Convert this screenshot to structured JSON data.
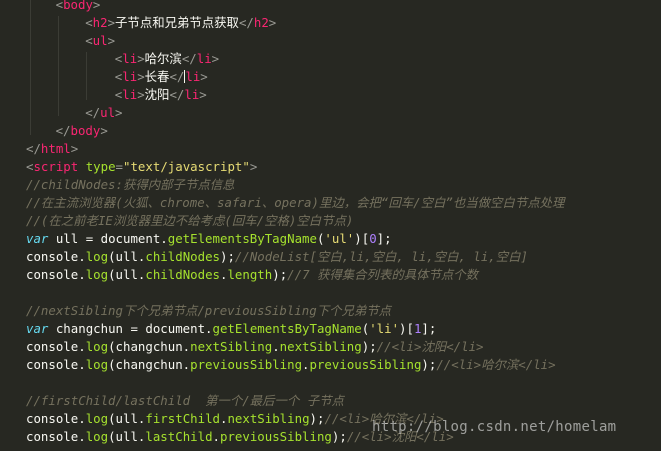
{
  "code_lines": [
    {
      "indent": 4,
      "tokens": [
        [
          "punct",
          "<"
        ],
        [
          "tag",
          "body"
        ],
        [
          "punct",
          ">"
        ]
      ]
    },
    {
      "indent": 8,
      "tokens": [
        [
          "punct",
          "<"
        ],
        [
          "tag",
          "h2"
        ],
        [
          "punct",
          ">"
        ],
        [
          "text",
          "子节点和兄弟节点获取"
        ],
        [
          "punct",
          "</"
        ],
        [
          "tag",
          "h2"
        ],
        [
          "punct",
          ">"
        ]
      ]
    },
    {
      "indent": 8,
      "tokens": [
        [
          "punct",
          "<"
        ],
        [
          "tag",
          "ul"
        ],
        [
          "punct",
          ">"
        ]
      ]
    },
    {
      "indent": 12,
      "tokens": [
        [
          "punct",
          "<"
        ],
        [
          "tag",
          "li"
        ],
        [
          "punct",
          ">"
        ],
        [
          "text",
          "哈尔滨"
        ],
        [
          "punct",
          "</"
        ],
        [
          "tag",
          "li"
        ],
        [
          "punct",
          ">"
        ]
      ]
    },
    {
      "indent": 12,
      "caret_after": 4,
      "tokens": [
        [
          "punct",
          "<"
        ],
        [
          "tag",
          "li"
        ],
        [
          "punct",
          ">"
        ],
        [
          "text",
          "长春"
        ],
        [
          "punct",
          "</"
        ],
        [
          "tag",
          "li"
        ],
        [
          "punct",
          ">"
        ]
      ]
    },
    {
      "indent": 12,
      "tokens": [
        [
          "punct",
          "<"
        ],
        [
          "tag",
          "li"
        ],
        [
          "punct",
          ">"
        ],
        [
          "text",
          "沈阳"
        ],
        [
          "punct",
          "</"
        ],
        [
          "tag",
          "li"
        ],
        [
          "punct",
          ">"
        ]
      ]
    },
    {
      "indent": 8,
      "tokens": [
        [
          "punct",
          "</"
        ],
        [
          "tag",
          "ul"
        ],
        [
          "punct",
          ">"
        ]
      ]
    },
    {
      "indent": 4,
      "tokens": [
        [
          "punct",
          "</"
        ],
        [
          "tag",
          "body"
        ],
        [
          "punct",
          ">"
        ]
      ]
    },
    {
      "indent": 0,
      "tokens": [
        [
          "punct",
          "</"
        ],
        [
          "tag",
          "html"
        ],
        [
          "punct",
          ">"
        ]
      ]
    },
    {
      "indent": 0,
      "tokens": [
        [
          "punct",
          "<"
        ],
        [
          "tag",
          "script"
        ],
        [
          "text",
          " "
        ],
        [
          "attr",
          "type"
        ],
        [
          "punct",
          "="
        ],
        [
          "str",
          "\"text/javascript\""
        ],
        [
          "punct",
          ">"
        ]
      ]
    },
    {
      "indent": 0,
      "tokens": [
        [
          "comment",
          "//childNodes:获得内部子节点信息"
        ]
      ]
    },
    {
      "indent": 0,
      "tokens": [
        [
          "comment",
          "//在主流浏览器(火狐、chrome、safari、opera)里边，会把“回车/空白”也当做空白节点处理"
        ]
      ]
    },
    {
      "indent": 0,
      "tokens": [
        [
          "comment",
          "//(在之前老IE浏览器里边不给考虑(回车/空格)空白节点)"
        ]
      ]
    },
    {
      "indent": 0,
      "tokens": [
        [
          "kw",
          "var"
        ],
        [
          "var",
          " ull = document."
        ],
        [
          "func",
          "getElementsByTagName"
        ],
        [
          "var",
          "("
        ],
        [
          "str",
          "'ul'"
        ],
        [
          "var",
          ")["
        ],
        [
          "num",
          "0"
        ],
        [
          "var",
          "];"
        ]
      ]
    },
    {
      "indent": 0,
      "tokens": [
        [
          "var",
          "console."
        ],
        [
          "func",
          "log"
        ],
        [
          "var",
          "(ull."
        ],
        [
          "func",
          "childNodes"
        ],
        [
          "var",
          ");"
        ],
        [
          "comment",
          "//NodeList[空白,li,空白, li,空白, li,空白]"
        ]
      ]
    },
    {
      "indent": 0,
      "tokens": [
        [
          "var",
          "console."
        ],
        [
          "func",
          "log"
        ],
        [
          "var",
          "(ull."
        ],
        [
          "func",
          "childNodes"
        ],
        [
          "var",
          "."
        ],
        [
          "func",
          "length"
        ],
        [
          "var",
          ");"
        ],
        [
          "comment",
          "//7 获得集合列表的具体节点个数"
        ]
      ]
    },
    {
      "indent": 0,
      "tokens": []
    },
    {
      "indent": 0,
      "tokens": [
        [
          "comment",
          "//nextSibling下个兄弟节点/previousSibling下个兄弟节点"
        ]
      ]
    },
    {
      "indent": 0,
      "tokens": [
        [
          "kw",
          "var"
        ],
        [
          "var",
          " changchun = document."
        ],
        [
          "func",
          "getElementsByTagName"
        ],
        [
          "var",
          "("
        ],
        [
          "str",
          "'li'"
        ],
        [
          "var",
          ")["
        ],
        [
          "num",
          "1"
        ],
        [
          "var",
          "];"
        ]
      ]
    },
    {
      "indent": 0,
      "tokens": [
        [
          "var",
          "console."
        ],
        [
          "func",
          "log"
        ],
        [
          "var",
          "(changchun."
        ],
        [
          "func",
          "nextSibling"
        ],
        [
          "var",
          "."
        ],
        [
          "func",
          "nextSibling"
        ],
        [
          "var",
          ");"
        ],
        [
          "comment",
          "//<li>沈阳</li>"
        ]
      ]
    },
    {
      "indent": 0,
      "tokens": [
        [
          "var",
          "console."
        ],
        [
          "func",
          "log"
        ],
        [
          "var",
          "(changchun."
        ],
        [
          "func",
          "previousSibling"
        ],
        [
          "var",
          "."
        ],
        [
          "func",
          "previousSibling"
        ],
        [
          "var",
          ");"
        ],
        [
          "comment",
          "//<li>哈尔滨</li>"
        ]
      ]
    },
    {
      "indent": 0,
      "tokens": []
    },
    {
      "indent": 0,
      "tokens": [
        [
          "comment",
          "//firstChild/lastChild  第一个/最后一个 子节点"
        ]
      ]
    },
    {
      "indent": 0,
      "tokens": [
        [
          "var",
          "console."
        ],
        [
          "func",
          "log"
        ],
        [
          "var",
          "(ull."
        ],
        [
          "func",
          "firstChild"
        ],
        [
          "var",
          "."
        ],
        [
          "func",
          "nextSibling"
        ],
        [
          "var",
          ");"
        ],
        [
          "comment",
          "//<li>哈尔滨</li>"
        ]
      ]
    },
    {
      "indent": 0,
      "tokens": [
        [
          "var",
          "console."
        ],
        [
          "func",
          "log"
        ],
        [
          "var",
          "(ull."
        ],
        [
          "func",
          "lastChild"
        ],
        [
          "var",
          "."
        ],
        [
          "func",
          "previousSibling"
        ],
        [
          "var",
          ");"
        ],
        [
          "comment",
          "//<li>沈阳</li>"
        ]
      ]
    }
  ],
  "watermark": "http://blog.csdn.net/homelam",
  "colors": {
    "background": "#272822",
    "tag": "#f92672",
    "punct": "#9a9a94",
    "text": "#f8f8f2",
    "attr": "#a6e22e",
    "string": "#e6db74",
    "keyword": "#66d9ef",
    "function": "#a6e22e",
    "number": "#ae81ff",
    "comment": "#75715e"
  }
}
